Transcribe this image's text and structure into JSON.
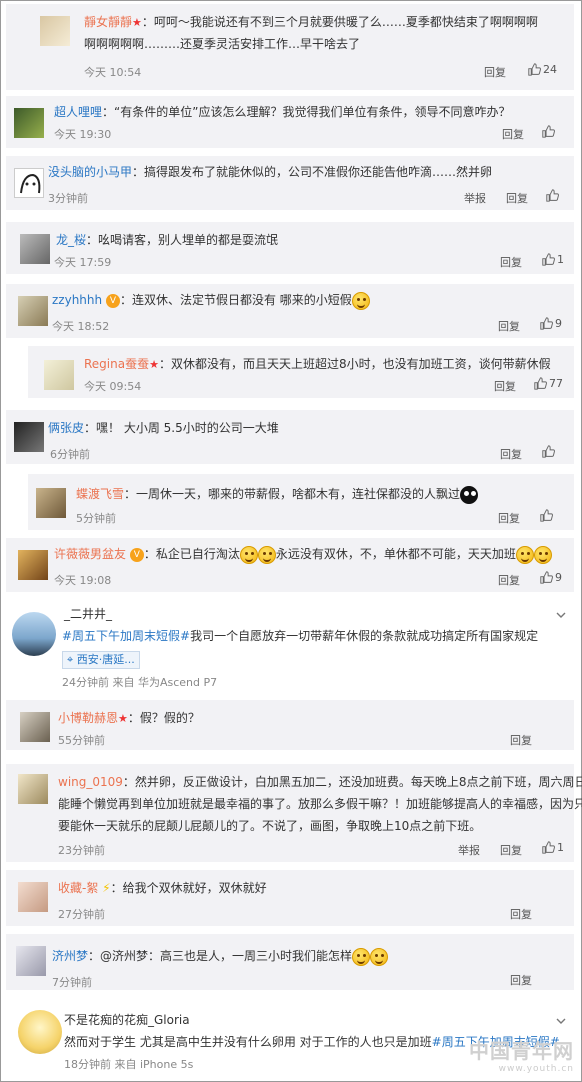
{
  "comments": [
    {
      "user": "靜女靜靜",
      "text1": "：呵呵～我能说还有不到三个月就要供暖了么……夏季都快结束了啊啊啊啊",
      "text2": "啊啊啊啊啊………还夏季灵活安排工作…早干啥去了",
      "time": "今天 10:54",
      "reply": "回复",
      "likes": "24"
    },
    {
      "user": "超人哩哩",
      "text1": "：“有条件的单位”应该怎么理解？我觉得我们单位有条件，领导不同意咋办？",
      "time": "今天 19:30",
      "reply": "回复",
      "likes": ""
    },
    {
      "user": "没头脑的小马甲",
      "text1": "：搞得跟发布了就能休似的，公司不准假你还能告他咋滴……然并卵",
      "time": "3分钟前",
      "report": "举报",
      "reply": "回复",
      "likes": ""
    },
    {
      "user": "龙_桜",
      "text1": "：吆喝请客，别人埋单的都是耍流氓",
      "time": "今天 17:59",
      "reply": "回复",
      "likes": "1"
    },
    {
      "user": "zzyhhhh",
      "text1": "：连双休、法定节假日都没有 哪来的小短假",
      "time": "今天 18:52",
      "reply": "回复",
      "likes": "9"
    },
    {
      "user": "Regina蚕蚕",
      "text1": "：双休都没有，而且天天上班超过8小时，也没有加班工资，谈何带薪休假",
      "time": "今天 09:54",
      "reply": "回复",
      "likes": "77"
    },
    {
      "user": "俩张皮",
      "text1": "：嘿！ 大小周 5.5小时的公司一大堆",
      "time": "6分钟前",
      "reply": "回复",
      "likes": ""
    },
    {
      "user": "蝶渡飞雪",
      "text1": "：一周休一天，哪来的带薪假，啥都木有，连社保都没的人飘过",
      "time": "5分钟前",
      "reply": "回复",
      "likes": ""
    },
    {
      "user": "许薇薇男盆友",
      "text1": "：私企已自行淘汰",
      "text1b": "永远没有双休，不，单休都不可能，天天加班",
      "time": "今天 19:08",
      "reply": "回复",
      "likes": "9"
    }
  ],
  "post1": {
    "user": "_二井井_",
    "tag": "#周五下午加周末短假#",
    "text": "我司一个自愿放弃一切带薪年休假的条款就成功搞定所有国家规定",
    "location": "西安·唐延...",
    "meta": "24分钟前 来自 华为Ascend P7"
  },
  "replies": [
    {
      "user": "小博勒赫恩",
      "text1": "：假？假的？",
      "time": "55分钟前",
      "reply": "回复",
      "likes": ""
    },
    {
      "user": "wing_0109",
      "text1": "：然并卵，反正做设计，白加黑五加二，还没加班费。每天晚上8点之前下班，周六周日",
      "text2": "能睡个懒觉再到单位加班就是最幸福的事了。放那么多假干嘛？！加班能够提高人的幸福感，因为只",
      "text3": "要能休一天就乐的屁颠儿屁颠儿的了。不说了，画图，争取晚上10点之前下班。",
      "time": "23分钟前",
      "report": "举报",
      "reply": "回复",
      "likes": "1"
    },
    {
      "user": "收藏-絮",
      "text1": "：给我个双休就好，双休就好",
      "time": "27分钟前",
      "reply": "回复",
      "likes": ""
    },
    {
      "user": "济州梦",
      "text1": "：@济州梦：高三也是人，一周三小时我们能怎样",
      "time": "7分钟前",
      "reply": "回复",
      "likes": ""
    }
  ],
  "post2": {
    "user": "不是花痴的花痴_Gloria",
    "text": "然而对于学生 尤其是高中生并没有什么卵用 对于工作的人也只是加班",
    "tag": "#周五下午加周末短假#",
    "meta": "18分钟前 来自 iPhone 5s"
  },
  "watermark": {
    "main": "中国青年网",
    "sub": "www.youth.cn"
  },
  "colors": {
    "accent": "#eb7350",
    "link": "#2a77c4",
    "block": "#f2f2f5"
  }
}
